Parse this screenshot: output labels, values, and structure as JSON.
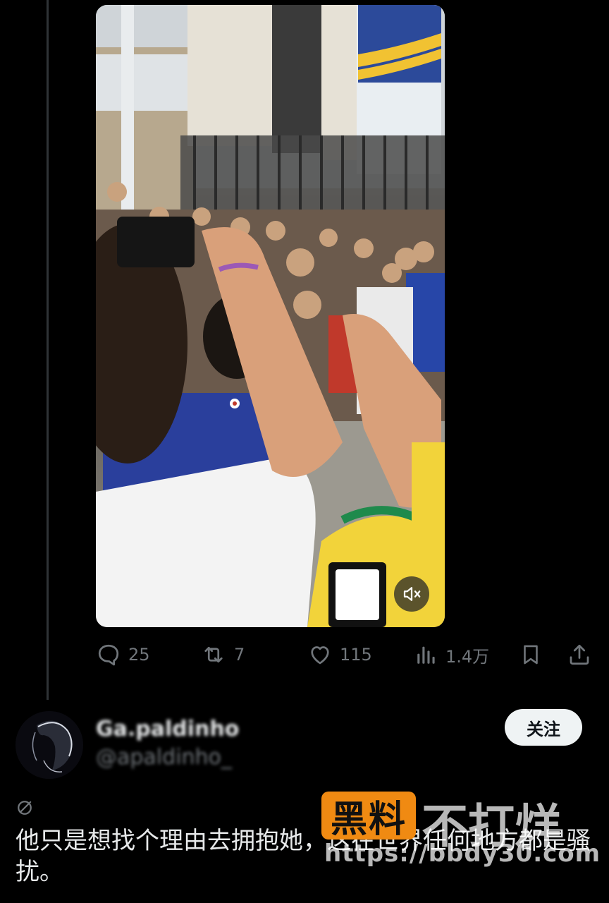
{
  "colors": {
    "background": "#000000",
    "text_primary": "#e7e9ea",
    "text_secondary": "#71767b",
    "follow_button_bg": "#eff3f4",
    "watermark_orange": "#f08a12"
  },
  "video": {
    "mute_icon": "speaker-muted-icon"
  },
  "actions": {
    "replies": {
      "icon": "speech-bubble-icon",
      "count": "25"
    },
    "reposts": {
      "icon": "repost-icon",
      "count": "7"
    },
    "likes": {
      "icon": "heart-icon",
      "count": "115"
    },
    "views": {
      "icon": "bar-chart-icon",
      "count": "1.4万"
    },
    "bookmark": {
      "icon": "bookmark-icon"
    },
    "share": {
      "icon": "share-upload-icon"
    }
  },
  "reply": {
    "display_name": "Ga.paldinho",
    "handle": "@apaldinho_",
    "follow_label": "关注",
    "text": "他只是想找个理由去拥抱她，这在世界任何地方都是骚扰。"
  },
  "watermark": {
    "badge": "黑料",
    "title": "不打烊",
    "url": "https://bbdy30.com"
  }
}
